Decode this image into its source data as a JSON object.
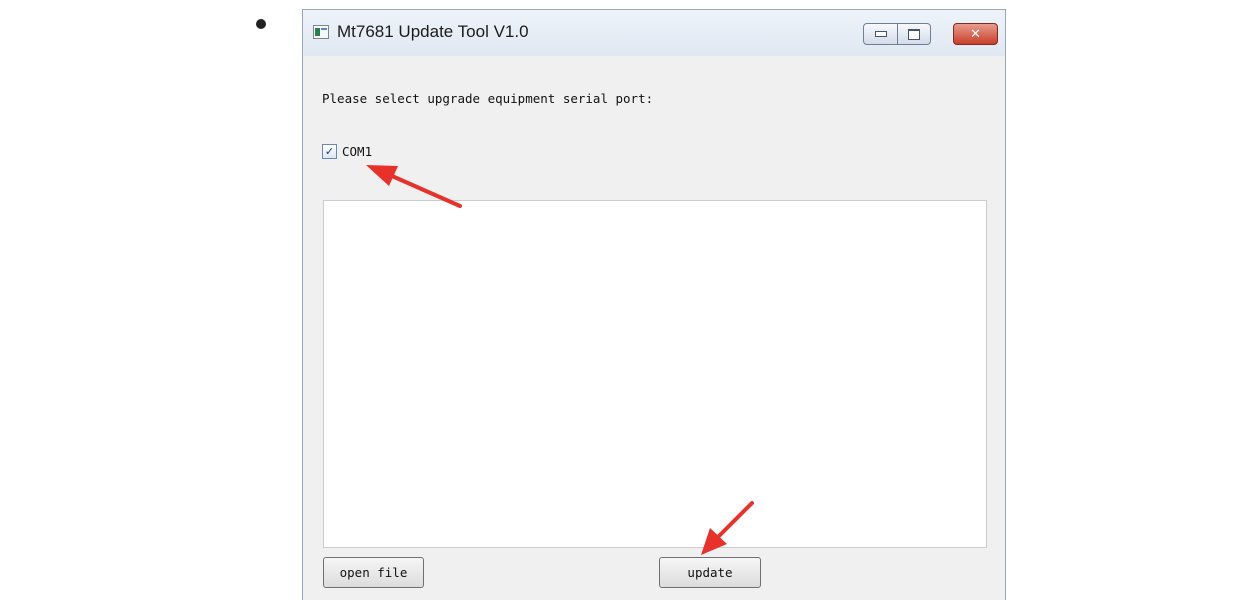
{
  "window": {
    "title": "Mt7681 Update Tool V1.0",
    "icon": "app-window-icon",
    "controls": {
      "minimize_icon": "minimize-icon",
      "maximize_icon": "maximize-icon",
      "close_icon": "close-icon",
      "close_glyph": "✕"
    }
  },
  "content": {
    "prompt": "Please select upgrade equipment serial port:",
    "port": {
      "label": "COM1",
      "checked": true,
      "check_glyph": "✓"
    },
    "log_text": ""
  },
  "buttons": {
    "open_file": "open file",
    "update": "update"
  },
  "annotations": {
    "arrow_color": "#e8312a",
    "arrows": [
      "arrow-to-com1",
      "arrow-to-update"
    ]
  },
  "colors": {
    "window_border": "#9aa7b8",
    "client_bg": "#f0f0f0",
    "close_button": "#c8402b"
  }
}
